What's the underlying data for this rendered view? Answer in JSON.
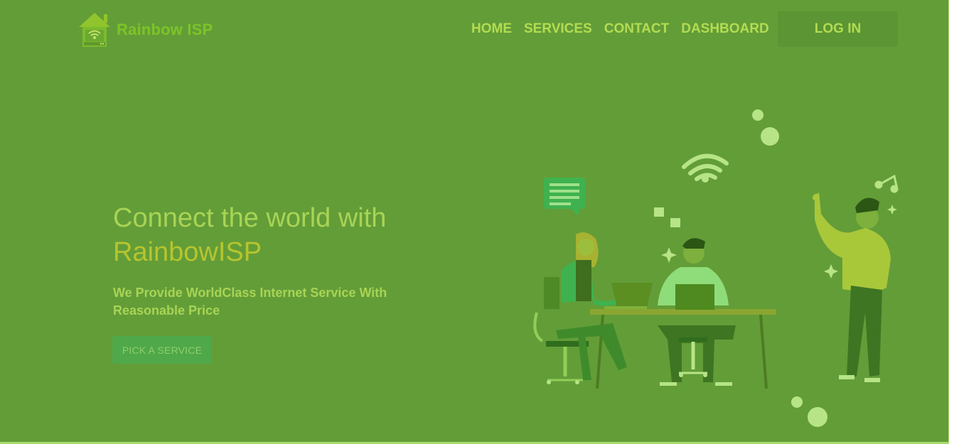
{
  "header": {
    "brand": "Rainbow ISP",
    "nav": [
      "HOME",
      "SERVICES",
      "CONTACT",
      "DASHBOARD"
    ],
    "login_label": "LOG IN"
  },
  "hero": {
    "title_line1": "Connect the world with",
    "title_line2": "RainbowISP",
    "subtitle": "We Provide WorldClass Internet Service With Reasonable Price",
    "cta_label": "PICK A SERVICE"
  },
  "icons": {
    "logo": "house-router-logo-icon",
    "illustration": "people-working-with-laptops-illustration"
  },
  "colors": {
    "background": "#639d38",
    "brand": "#7dc427",
    "nav_text": "#b3dc52",
    "title": "#a8d455",
    "title_accent": "#b6c52d",
    "cta_bg": "#4fa849"
  }
}
